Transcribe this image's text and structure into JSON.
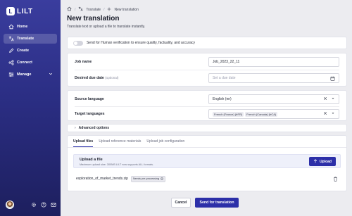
{
  "app": {
    "logo_text": "LILT",
    "logo_mark": "L"
  },
  "sidebar": {
    "items": [
      {
        "label": "Home",
        "icon": "home-icon"
      },
      {
        "label": "Translate",
        "icon": "translate-icon",
        "active": true
      },
      {
        "label": "Create",
        "icon": "create-icon"
      },
      {
        "label": "Connect",
        "icon": "connect-icon"
      },
      {
        "label": "Manage",
        "icon": "manage-icon"
      }
    ]
  },
  "breadcrumb": {
    "items": [
      "Translate",
      "New translation"
    ]
  },
  "page": {
    "title": "New translation",
    "subtitle": "Translate text or upload a file to translate instantly."
  },
  "toggle": {
    "label": "Send for Human verification to ensure quality, factuality, and accuracy",
    "checked": false
  },
  "form": {
    "job_name_label": "Job name",
    "job_name_value": "Job_2023_22_11",
    "due_date_label": "Desired due date",
    "due_date_optional": "(optional)",
    "due_date_placeholder": "Set a due date"
  },
  "languages": {
    "source_label": "Source language",
    "source_value": "English (en)",
    "target_label": "Target languages",
    "target_values": [
      "French (France) (frFR)",
      "French (Canada) (frCA)"
    ]
  },
  "advanced": {
    "label": "Advanced options"
  },
  "upload": {
    "tabs": [
      "Upload files",
      "Upload reference materials",
      "Upload job configuration"
    ],
    "title": "Upload a file",
    "subtitle": "Maximum upload size: 300MB LILT now supports ALL formats.",
    "button": "Upload",
    "file_name": "exploration_of_market_trends.zip",
    "file_badge": "Needs pre-processing"
  },
  "actions": {
    "cancel": "Cancel",
    "send": "Send for translation"
  },
  "colors": {
    "accent": "#2c2fa8",
    "sidebar": "#2b2e84"
  }
}
